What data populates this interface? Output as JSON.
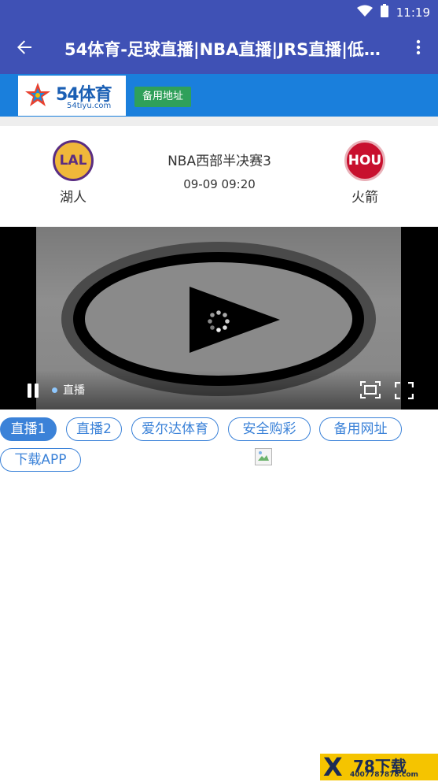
{
  "status_bar": {
    "time": "11:19",
    "wifi_icon": "wifi-icon",
    "battery_icon": "battery-icon"
  },
  "app_bar": {
    "title": "54体育-足球直播|NBA直播|JRS直播|低…",
    "back_icon": "arrow-back-icon",
    "menu_icon": "more-vert-icon"
  },
  "site_header": {
    "logo_text": "54体育",
    "logo_domain": "54tiyu.com",
    "backup_label": "备用地址",
    "accent": "#1a7fdc",
    "button_color": "#2fa05a"
  },
  "match": {
    "title": "NBA西部半决赛3",
    "time": "09-09 09:20",
    "home": {
      "name": "湖人",
      "abbr": "LAL",
      "color": "#5a2d82",
      "accent": "#f0b83a"
    },
    "away": {
      "name": "火箭",
      "abbr": "HOU",
      "color": "#c8102e",
      "accent": "#ffffff"
    }
  },
  "player": {
    "live_label": "直播",
    "pause_icon": "pause-icon",
    "screen_icon": "screen-mode-icon",
    "fullscreen_icon": "fullscreen-icon",
    "play_icon": "play-icon",
    "loading_icon": "loading-spinner-icon"
  },
  "tabs": [
    {
      "label": "直播1",
      "active": true
    },
    {
      "label": "直播2",
      "active": false
    },
    {
      "label": "爱尔达体育",
      "active": false
    },
    {
      "label": "安全购彩",
      "active": false
    },
    {
      "label": "备用网址",
      "active": false
    },
    {
      "label": "下载APP",
      "active": false
    }
  ],
  "watermark": {
    "logo": "X",
    "text": "78下载",
    "url": "4007787878.com",
    "color": "#f5c400"
  }
}
